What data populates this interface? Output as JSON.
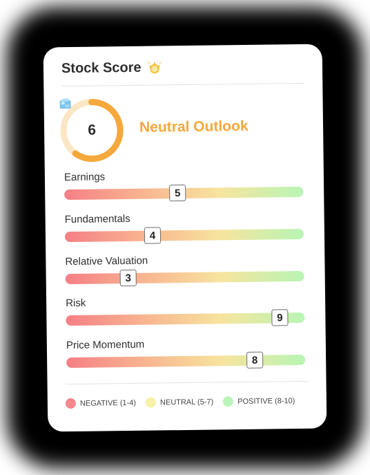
{
  "card": {
    "title": "Stock Score",
    "title_icon": "sparkle-icon"
  },
  "overall": {
    "score": "6",
    "score_value": 6,
    "score_max": 10,
    "icon": "ice-cube-icon",
    "outlook": "Neutral Outlook",
    "color": "#f5a83b",
    "track_color": "#fbe6c6"
  },
  "metrics": [
    {
      "label": "Earnings",
      "score": "5",
      "value": 5
    },
    {
      "label": "Fundamentals",
      "score": "4",
      "value": 4
    },
    {
      "label": "Relative Valuation",
      "score": "3",
      "value": 3
    },
    {
      "label": "Risk",
      "score": "9",
      "value": 9
    },
    {
      "label": "Price Momentum",
      "score": "8",
      "value": 8
    }
  ],
  "legend": [
    {
      "label": "NEGATIVE (1-4)",
      "color": "#f4878c"
    },
    {
      "label": "NEUTRAL (5-7)",
      "color": "#f6f2a8"
    },
    {
      "label": "POSITIVE (8-10)",
      "color": "#b9f5b7"
    }
  ]
}
